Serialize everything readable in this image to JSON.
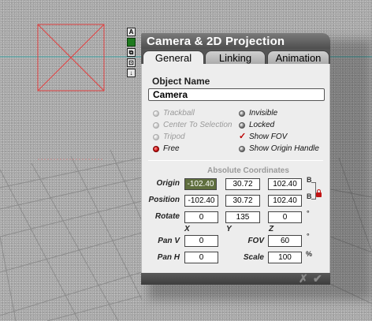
{
  "window": {
    "title": "Camera & 2D Projection",
    "tabs": [
      {
        "label": "General",
        "active": true
      },
      {
        "label": "Linking",
        "active": false
      },
      {
        "label": "Animation",
        "active": false
      }
    ]
  },
  "object_name": {
    "label": "Object Name",
    "value": "Camera"
  },
  "options": {
    "left": [
      {
        "label": "Trackball",
        "state": "disabled"
      },
      {
        "label": "Center To Selection",
        "state": "disabled"
      },
      {
        "label": "Tripod",
        "state": "disabled"
      },
      {
        "label": "Free",
        "state": "selected"
      }
    ],
    "right": [
      {
        "label": "Invisible",
        "state": "off"
      },
      {
        "label": "Locked",
        "state": "off"
      },
      {
        "label": "Show FOV",
        "state": "checked"
      },
      {
        "label": "Show Origin Handle",
        "state": "off"
      }
    ]
  },
  "coordinates": {
    "group_title": "Absolute Coordinates",
    "rows": [
      {
        "label": "Origin",
        "values": [
          "-102.40",
          "30.72",
          "102.40"
        ],
        "suffix": "B"
      },
      {
        "label": "Position",
        "values": [
          "-102.40",
          "30.72",
          "102.40"
        ],
        "suffix": "B"
      },
      {
        "label": "Rotate",
        "values": [
          "0",
          "135",
          "0"
        ],
        "suffix": "°"
      }
    ],
    "axes": [
      "X",
      "Y",
      "Z"
    ]
  },
  "pan": {
    "pan_v": {
      "label": "Pan V",
      "value": "0"
    },
    "pan_h": {
      "label": "Pan H",
      "value": "0"
    }
  },
  "fov": {
    "label": "FOV",
    "value": "60",
    "unit": "°"
  },
  "scale": {
    "label": "Scale",
    "value": "100",
    "unit": "%"
  },
  "footer": {
    "cancel_glyph": "✗",
    "ok_glyph": "✔"
  },
  "mini_toolbar": [
    "A",
    "■",
    "⧉",
    "⊡",
    "↓"
  ],
  "colors": {
    "title_bar": "#5a5a5a",
    "dialog_body": "#ededed",
    "selected_field": "#5f6f3e",
    "radio_selected": "#cc1111",
    "viewport_line": "#3aa0a0",
    "camera_box": "#e04040"
  }
}
